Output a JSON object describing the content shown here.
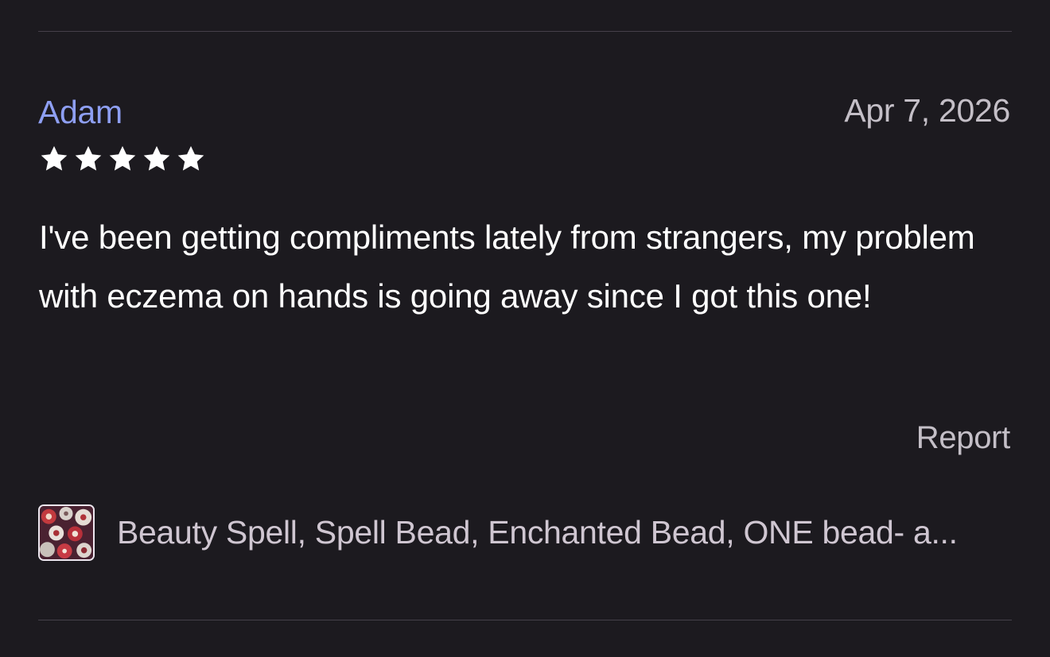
{
  "review": {
    "reviewer_name": "Adam",
    "date": "Apr 7, 2026",
    "rating": 5,
    "rating_max": 5,
    "star_icon": "star-icon",
    "text": "I've been getting compliments lately from strangers, my problem with eczema on hands is going away since I got this one!",
    "report_label": "Report"
  },
  "product": {
    "thumbnail_icon": "bead-product-thumbnail",
    "title": "Beauty Spell, Spell Bead, Enchanted Bead, ONE bead- a..."
  },
  "colors": {
    "background": "#1c1a1f",
    "reviewer_name": "#8e9ff3",
    "secondary_text": "#c4bfc7",
    "star": "#ffffff",
    "divider": "#45404a"
  }
}
